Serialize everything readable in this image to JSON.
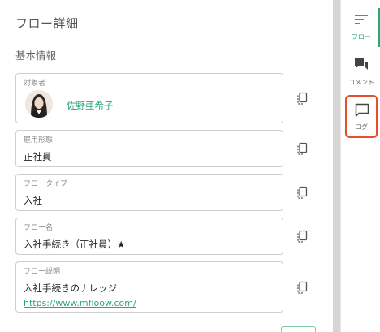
{
  "header": {
    "title": "フロー詳細"
  },
  "basic_info": {
    "section_title": "基本情報",
    "subject": {
      "label": "対象者",
      "name": "佐野亜希子"
    },
    "employment_type": {
      "label": "雇用形態",
      "value": "正社員"
    },
    "flow_type": {
      "label": "フロータイプ",
      "value": "入社"
    },
    "flow_name": {
      "label": "フロー名",
      "value": "入社手続き（正社員）★"
    },
    "flow_description": {
      "label": "フロー説明",
      "value": "入社手続きのナレッジ",
      "link": "https://www.mfloow.com/"
    }
  },
  "rail": {
    "items": [
      {
        "label": "フロー",
        "icon": "flow-icon",
        "active": true
      },
      {
        "label": "コメント",
        "icon": "comment-icon",
        "active": false
      },
      {
        "label": "ログ",
        "icon": "log-icon",
        "active": false
      }
    ]
  },
  "colors": {
    "accent": "#2aa876",
    "highlight": "#e2502e",
    "border": "#cfcfcf"
  }
}
